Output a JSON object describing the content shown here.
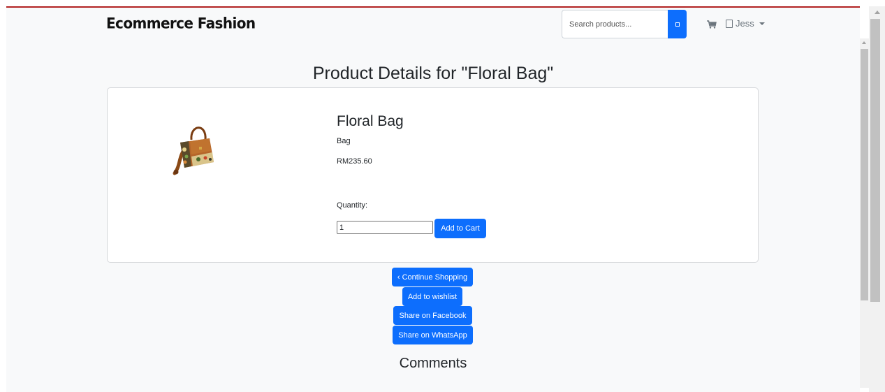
{
  "header": {
    "brand": "Ecommerce Fashion",
    "search_placeholder": "Search products...",
    "user_name": "Jess",
    "icons": {
      "search": "search-icon",
      "cart": "cart-icon",
      "user": "user-icon",
      "caret": "caret-down-icon"
    }
  },
  "page": {
    "title": "Product Details for \"Floral Bag\""
  },
  "product": {
    "name": "Floral Bag",
    "category": "Bag",
    "price": "RM235.60",
    "quantity_label": "Quantity:",
    "quantity_value": "1",
    "add_to_cart_label": "Add to Cart",
    "image_icon": "floral-handbag"
  },
  "actions": {
    "continue_shopping": "‹ Continue Shopping",
    "add_to_wishlist": "Add to wishlist",
    "share_facebook": "Share on Facebook",
    "share_whatsapp": "Share on WhatsApp"
  },
  "comments": {
    "heading": "Comments"
  },
  "colors": {
    "primary": "#0d6efd",
    "top_border": "#b22222",
    "background": "#f8f9fa"
  }
}
